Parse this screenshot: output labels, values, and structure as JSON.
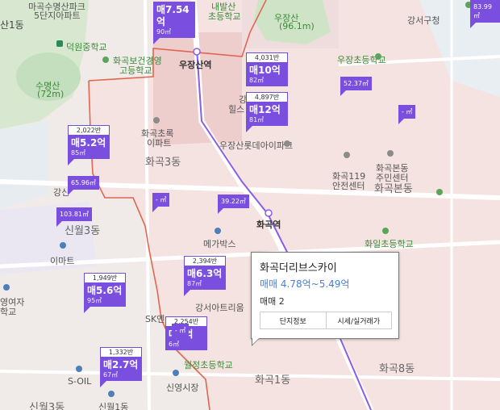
{
  "labels": {
    "top_left_school_1": "마곡수명산파크",
    "top_left_school_2": "5단지아파트",
    "top_left_cut": "산1동",
    "deokwon_ms": "덕원중학교",
    "susmyeongsan": "수명산",
    "susmyeongsan_h": "(72m)",
    "health_hs_1": "화곡보건경영",
    "health_hs_2": "고등학교",
    "ujangsan_station": "우장산역",
    "naebal": "내발산",
    "ujang_es": "초등학교",
    "ujangsan_1": "우장산",
    "ujangsan_2": "(96.1m)",
    "gangseo_gu": "강서구청",
    "ujang_es2": "우장초등학교",
    "hill_1": "강",
    "hill_2": "힐스",
    "ujang_sinbuk": "우장산롯데아이파크",
    "hwagok_chorok_1": "화곡초록",
    "hwagok_chorok_2": "이파트",
    "hwagok_3dong": "화곡3동",
    "hwagok_bondong_center_1": "화곡본동",
    "hwagok_bondong_center_2": "주민센터",
    "hwagok_119_1": "화곡119",
    "hwagok_119_2": "안전센터",
    "hwagok_bondong": "화곡본동",
    "hwagok_station": "화곡역",
    "gangsi": "강신",
    "sinwol_3": "신월3동",
    "emart": "이마트",
    "megabox": "메가박스",
    "hwail_es": "화일초등학교",
    "yeoja_1": "영여자",
    "yeoja_2": "학교",
    "gangseo_tree": "강서아트리움",
    "sk": "SK엔",
    "wolseo_es": "월정초등학교",
    "hwagok_1dong": "화곡1동",
    "hwagok_8dong": "화곡8동",
    "soil": "S-OIL",
    "sinyeong_market": "신영시장",
    "sinwol_3b": "신월3동",
    "sinwol_1": "신월1동"
  },
  "markers": [
    {
      "id": "m754",
      "price": "매7.54억",
      "area": "90㎡",
      "count": ""
    },
    {
      "id": "m10",
      "price": "매10억",
      "area": "82㎡",
      "count": "4,031반"
    },
    {
      "id": "m12",
      "price": "매12억",
      "area": "81㎡",
      "count": "4,897반"
    },
    {
      "id": "m52",
      "price": "매5.2억",
      "area": "85㎡",
      "count": "2,022반"
    },
    {
      "id": "m63",
      "price": "매6.3억",
      "area": "87㎡",
      "count": "2,394반"
    },
    {
      "id": "m56",
      "price": "매5.6억",
      "area": "95㎡",
      "count": "1,949반"
    },
    {
      "id": "m27",
      "price": "매2.7억",
      "area": "67㎡",
      "count": "1,332반"
    },
    {
      "id": "m4",
      "price": "매4억",
      "area": "6㎡",
      "count": "2,254반"
    }
  ],
  "minis": [
    {
      "id": "n1",
      "text": "83.99㎡"
    },
    {
      "id": "n2",
      "text": "52.37㎡"
    },
    {
      "id": "n3",
      "text": "- ㎡"
    },
    {
      "id": "n4",
      "text": "65.96㎡"
    },
    {
      "id": "n5",
      "text": "103.81㎡"
    },
    {
      "id": "n6",
      "text": "- ㎡"
    },
    {
      "id": "n7",
      "text": "39.22㎡"
    },
    {
      "id": "n8",
      "text": "- ㎡"
    }
  ],
  "popup": {
    "title": "화곡더리브스카이",
    "range": "매매 4.78억~5.49억",
    "count": "매매 2",
    "btn_info": "단지정보",
    "btn_price": "시세/실거래가"
  },
  "colors": {
    "marker": "#7a4fe0",
    "district_border": "#e0664f",
    "district_fill": "#f2d9d4",
    "subway_line": "#8a5de6"
  }
}
